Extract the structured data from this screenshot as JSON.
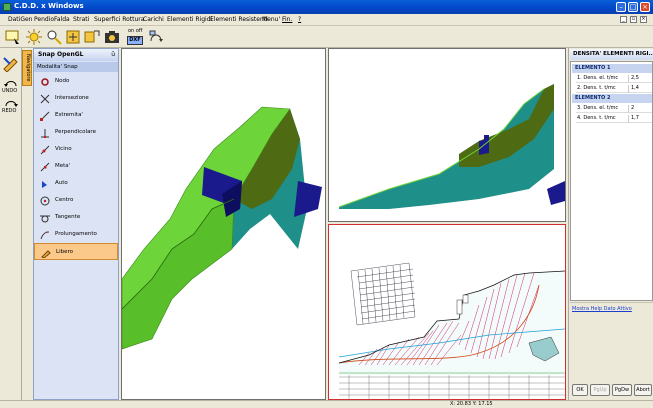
{
  "window": {
    "title": "C.D.D. x Windows"
  },
  "menu": [
    "DatiGen",
    "Pendio",
    "Falda",
    "Strati",
    "Superfici Rottura",
    "Carichi",
    "Elementi Rigidi",
    "Elementi Resistenti",
    "Menu'",
    "Fin.",
    "?"
  ],
  "toolbar": {
    "onoff_label": "on off",
    "dxf_label": "DXF"
  },
  "left_strip": {
    "undo_label": "UNDO",
    "redo_label": "REDO"
  },
  "vertical_tab": "Navigatore",
  "snap_panel": {
    "title": "Snap OpenGL",
    "pin": "ū",
    "mode_label": "Modalita' Snap",
    "items": [
      {
        "label": "Nodo",
        "icon": "node-icon"
      },
      {
        "label": "Intersezione",
        "icon": "intersection-icon"
      },
      {
        "label": "Estremita'",
        "icon": "endpoint-icon"
      },
      {
        "label": "Perpendicolare",
        "icon": "perpendicular-icon"
      },
      {
        "label": "Vicino",
        "icon": "near-icon"
      },
      {
        "label": "Meta'",
        "icon": "midpoint-icon"
      },
      {
        "label": "Auto",
        "icon": "auto-icon"
      },
      {
        "label": "Centro",
        "icon": "center-icon"
      },
      {
        "label": "Tangente",
        "icon": "tangent-icon"
      },
      {
        "label": "Prolungamento",
        "icon": "extension-icon"
      },
      {
        "label": "Libero",
        "icon": "free-icon",
        "selected": true
      }
    ]
  },
  "right_panel": {
    "title": "DENSITA' ELEMENTI RIGI...",
    "groups": [
      {
        "name": "ELEMENTO 1",
        "rows": [
          {
            "label": "1. Dens. el. t/mc",
            "value": "2,5"
          },
          {
            "label": "2. Dens. t. t/mc",
            "value": "1,4"
          }
        ]
      },
      {
        "name": "ELEMENTO 2",
        "rows": [
          {
            "label": "3. Dens. el. t/mc",
            "value": "2"
          },
          {
            "label": "4. Dens. t. t/mc",
            "value": "1,7"
          }
        ]
      }
    ],
    "help_link": "Mostra Help Dato Attivo",
    "buttons": [
      {
        "label": "OK",
        "enabled": true
      },
      {
        "label": "PgUp",
        "enabled": false
      },
      {
        "label": "PgDw",
        "enabled": true
      },
      {
        "label": "Abort",
        "enabled": true
      }
    ]
  },
  "status": {
    "coords": "X: 20.83  Y: 17.15"
  },
  "colors": {
    "accent_orange": "#f3b547",
    "slope_green": "#6dd43a",
    "ground_teal": "#1f8f8a",
    "wall_blue": "#1a1a8c"
  }
}
